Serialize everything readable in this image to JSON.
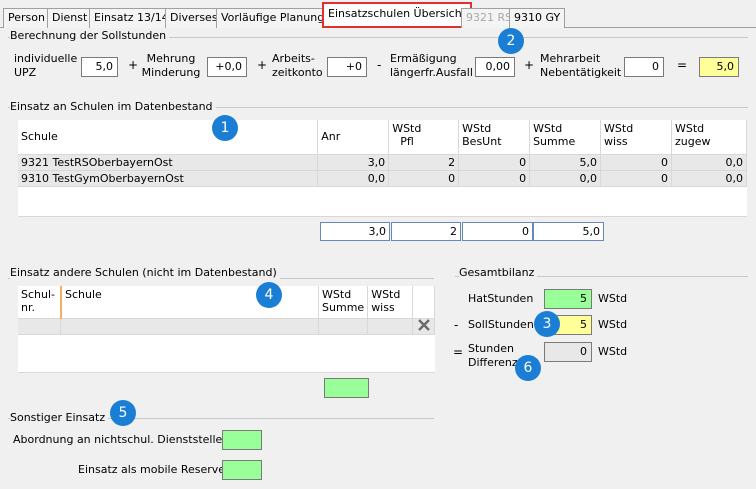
{
  "tabs": [
    {
      "label": "Person",
      "state": "normal"
    },
    {
      "label": "Dienst",
      "state": "normal"
    },
    {
      "label": "Einsatz 13/14",
      "state": "normal"
    },
    {
      "label": "Diverses",
      "state": "normal"
    },
    {
      "label": "Vorläufige Planung",
      "state": "normal"
    },
    {
      "label": "Einsatzschulen Übersicht",
      "state": "active"
    },
    {
      "label": "9321 RS",
      "state": "disabled"
    },
    {
      "label": "9310 GY",
      "state": "normal"
    }
  ],
  "soll": {
    "title": "Berechnung der Sollstunden",
    "upz_label": "individuelle UPZ",
    "upz_value": "5,0",
    "plus1": "+",
    "mehrung_label": "Mehrung Minderung",
    "mehrung_value": "+0,0",
    "plus2": "+",
    "konto_label": "Arbeits- zeitkonto",
    "konto_value": "+0",
    "minus": "-",
    "erm_label": "Ermäßigung längerfr.Ausfall",
    "erm_value": "0,00",
    "plus3": "+",
    "mehr_label": "Mehrarbeit Nebentätigkeit",
    "mehr_value": "0",
    "eq": "=",
    "result": "5,0"
  },
  "schulen": {
    "title": "Einsatz an Schulen im Datenbestand",
    "headers": {
      "schule": "Schule",
      "anr": "Anr",
      "pfl_1": "WStd",
      "pfl_2": "Pfl",
      "bes_1": "WStd",
      "bes_2": "BesUnt",
      "sum_1": "WStd",
      "sum_2": "Summe",
      "wiss_1": "WStd",
      "wiss_2": "wiss",
      "zug_1": "WStd",
      "zug_2": "zugew"
    },
    "rows": [
      {
        "schule": "9321 TestRSOberbayernOst",
        "anr": "3,0",
        "pfl": "2",
        "bes": "0",
        "sum": "5,0",
        "wiss": "0",
        "zug": "0,0"
      },
      {
        "schule": "9310 TestGymOberbayernOst",
        "anr": "0,0",
        "pfl": "0",
        "bes": "0",
        "sum": "0,0",
        "wiss": "0",
        "zug": "0,0"
      }
    ],
    "totals": {
      "anr": "3,0",
      "pfl": "2",
      "bes": "0",
      "sum": "5,0"
    }
  },
  "andere": {
    "title": "Einsatz andere Schulen (nicht im Datenbestand)",
    "headers": {
      "nr_1": "Schul-",
      "nr_2": "nr.",
      "schule": "Schule",
      "sum_1": "WStd",
      "sum_2": "Summe",
      "wiss_1": "WStd",
      "wiss_2": "wiss"
    },
    "delete_icon": "close-icon"
  },
  "bilanz": {
    "title": "Gesamtbilanz",
    "hat_label": "HatStunden",
    "hat_value": "5",
    "hat_unit": "WStd",
    "minus": "-",
    "soll_label": "SollStunden",
    "soll_value": "5",
    "soll_unit": "WStd",
    "eq": "=",
    "diff_label_1": "Stunden",
    "diff_label_2": "Differenz",
    "diff_value": "0",
    "diff_unit": "WStd"
  },
  "sonstig": {
    "title": "Sonstiger Einsatz",
    "abordnung_label": "Abordnung an nichtschul. Dienststelle",
    "mobil_label": "Einsatz als mobile Reserve"
  },
  "badges": [
    "1",
    "2",
    "3",
    "4",
    "5",
    "6"
  ],
  "colors": {
    "accent_badge": "#1a7fd4",
    "active_tab_border": "#e03030",
    "green_field": "#99ff99",
    "yellow_field": "#ffff99"
  }
}
